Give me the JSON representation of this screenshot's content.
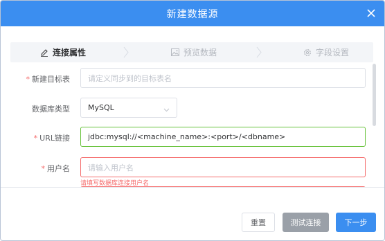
{
  "dialog": {
    "title": "新建数据源"
  },
  "steps": [
    {
      "label": "连接属性",
      "icon": "edit-icon",
      "active": true
    },
    {
      "label": "预览数据",
      "icon": "image-icon",
      "active": false
    },
    {
      "label": "字段设置",
      "icon": "gear-icon",
      "active": false
    }
  ],
  "form": {
    "target_table": {
      "label": "新建目标表",
      "required": "*",
      "placeholder": "请定义同步到的目标表名"
    },
    "db_type": {
      "label": "数据库类型",
      "value": "MySQL"
    },
    "url": {
      "label": "URL链接",
      "required": "*",
      "value": "jdbc:mysql://<machine_name>:<port>/<dbname>"
    },
    "username": {
      "label": "用户名",
      "required": "*",
      "placeholder": "请输入用户名",
      "error": "请填写数据库连接用户名"
    }
  },
  "footer": {
    "reset": "重置",
    "test": "测试连接",
    "next": "下一步"
  },
  "colors": {
    "primary": "#3b8ef0",
    "success": "#67c23a",
    "danger": "#f56c6c",
    "disabled": "#9aa0a8"
  }
}
